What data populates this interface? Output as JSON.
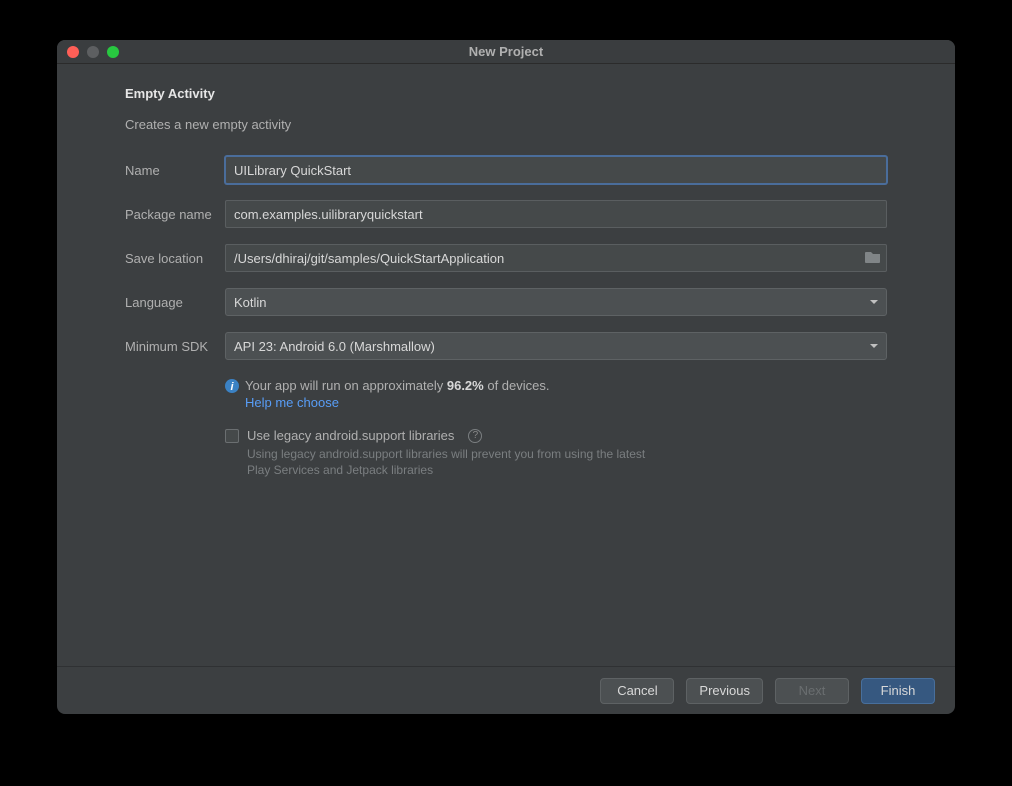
{
  "window": {
    "title": "New Project"
  },
  "heading": "Empty Activity",
  "subtitle": "Creates a new empty activity",
  "fields": {
    "name": {
      "label": "Name",
      "value": "UILibrary QuickStart"
    },
    "package": {
      "label": "Package name",
      "value": "com.examples.uilibraryquickstart"
    },
    "location": {
      "label": "Save location",
      "value": "/Users/dhiraj/git/samples/QuickStartApplication"
    },
    "language": {
      "label": "Language",
      "value": "Kotlin"
    },
    "minsdk": {
      "label": "Minimum SDK",
      "value": "API 23: Android 6.0 (Marshmallow)"
    }
  },
  "info": {
    "prefix": "Your app will run on approximately ",
    "percent": "96.2%",
    "suffix": " of devices.",
    "help_link": "Help me choose"
  },
  "legacy": {
    "label": "Use legacy android.support libraries",
    "note": "Using legacy android.support libraries will prevent you from using the latest Play Services and Jetpack libraries"
  },
  "buttons": {
    "cancel": "Cancel",
    "previous": "Previous",
    "next": "Next",
    "finish": "Finish"
  }
}
